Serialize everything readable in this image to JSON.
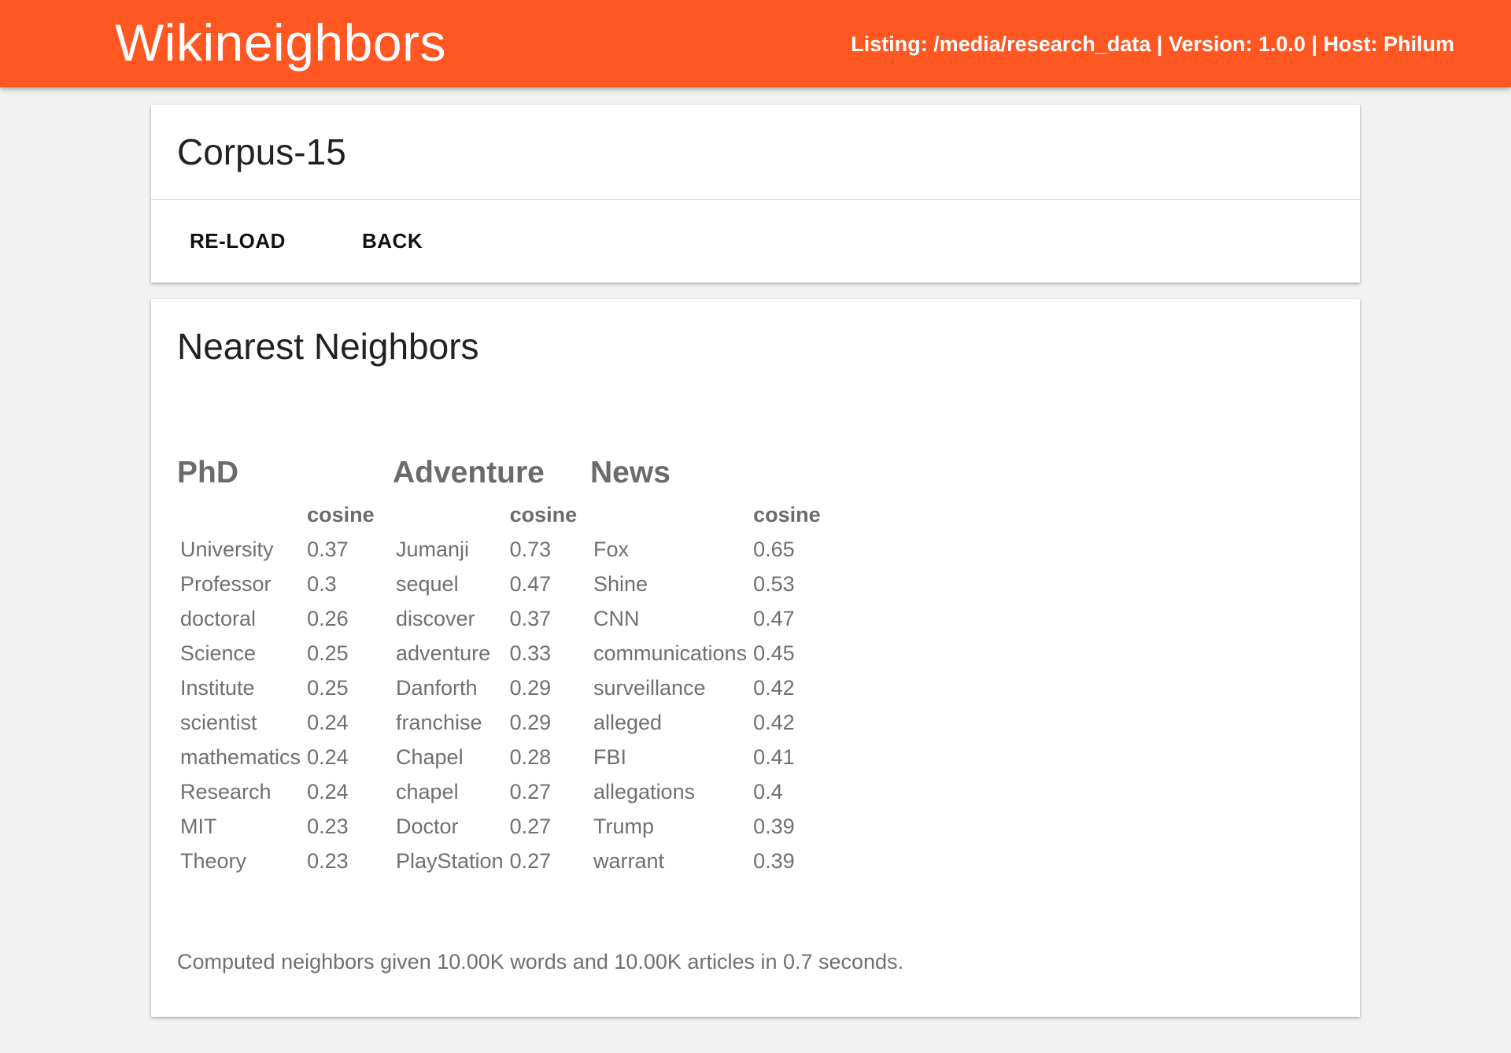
{
  "header": {
    "brand": "Wikineighbors",
    "info": "Listing: /media/research_data | Version: 1.0.0 | Host: Philum"
  },
  "corpus": {
    "title": "Corpus-15",
    "reload_label": "RE-LOAD",
    "back_label": "BACK"
  },
  "neighbors": {
    "title": "Nearest Neighbors",
    "score_header": "cosine",
    "groups": [
      {
        "query": "PhD",
        "rows": [
          {
            "word": "University",
            "score": "0.37"
          },
          {
            "word": "Professor",
            "score": "0.3"
          },
          {
            "word": "doctoral",
            "score": "0.26"
          },
          {
            "word": "Science",
            "score": "0.25"
          },
          {
            "word": "Institute",
            "score": "0.25"
          },
          {
            "word": "scientist",
            "score": "0.24"
          },
          {
            "word": "mathematics",
            "score": "0.24"
          },
          {
            "word": "Research",
            "score": "0.24"
          },
          {
            "word": "MIT",
            "score": "0.23"
          },
          {
            "word": "Theory",
            "score": "0.23"
          }
        ]
      },
      {
        "query": "Adventure",
        "rows": [
          {
            "word": "Jumanji",
            "score": "0.73"
          },
          {
            "word": "sequel",
            "score": "0.47"
          },
          {
            "word": "discover",
            "score": "0.37"
          },
          {
            "word": "adventure",
            "score": "0.33"
          },
          {
            "word": "Danforth",
            "score": "0.29"
          },
          {
            "word": "franchise",
            "score": "0.29"
          },
          {
            "word": "Chapel",
            "score": "0.28"
          },
          {
            "word": "chapel",
            "score": "0.27"
          },
          {
            "word": "Doctor",
            "score": "0.27"
          },
          {
            "word": "PlayStation",
            "score": "0.27"
          }
        ]
      },
      {
        "query": "News",
        "rows": [
          {
            "word": "Fox",
            "score": "0.65"
          },
          {
            "word": "Shine",
            "score": "0.53"
          },
          {
            "word": "CNN",
            "score": "0.47"
          },
          {
            "word": "communications",
            "score": "0.45"
          },
          {
            "word": "surveillance",
            "score": "0.42"
          },
          {
            "word": "alleged",
            "score": "0.42"
          },
          {
            "word": "FBI",
            "score": "0.41"
          },
          {
            "word": "allegations",
            "score": "0.4"
          },
          {
            "word": "Trump",
            "score": "0.39"
          },
          {
            "word": "warrant",
            "score": "0.39"
          }
        ]
      }
    ],
    "footer": "Computed neighbors given 10.00K words and 10.00K articles in 0.7 seconds."
  },
  "colors": {
    "accent": "#ff5722",
    "page_background": "#f2f2f2"
  }
}
